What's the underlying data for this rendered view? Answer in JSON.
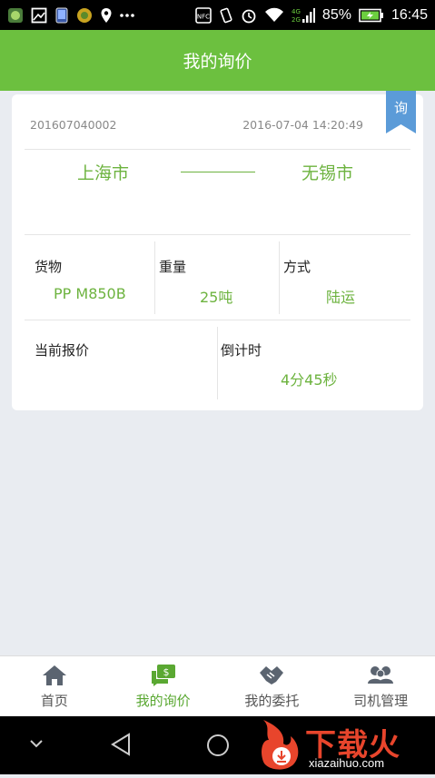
{
  "status_bar": {
    "battery": "85%",
    "time": "16:45",
    "network": "4G 2G"
  },
  "header": {
    "title": "我的询价"
  },
  "card": {
    "badge": "询",
    "order_no": "201607040002",
    "datetime": "2016-07-04 14:20:49",
    "origin": "上海市",
    "destination": "无锡市",
    "goods_label": "货物",
    "goods_value": "PP M850B",
    "weight_label": "重量",
    "weight_value": "25吨",
    "mode_label": "方式",
    "mode_value": "陆运",
    "quote_label": "当前报价",
    "quote_value": "",
    "countdown_label": "倒计时",
    "countdown_value": "4分45秒"
  },
  "bottom_nav": {
    "items": [
      {
        "label": "首页",
        "icon": "home-icon"
      },
      {
        "label": "我的询价",
        "icon": "quote-chat-icon"
      },
      {
        "label": "我的委托",
        "icon": "handshake-icon"
      },
      {
        "label": "司机管理",
        "icon": "drivers-icon"
      }
    ],
    "active_index": 1
  },
  "watermark": {
    "brand": "下载火",
    "domain": "xiazaihuo.com"
  },
  "colors": {
    "accent": "#6cc03f",
    "text_green": "#6db33f",
    "badge": "#5b9bd8"
  }
}
